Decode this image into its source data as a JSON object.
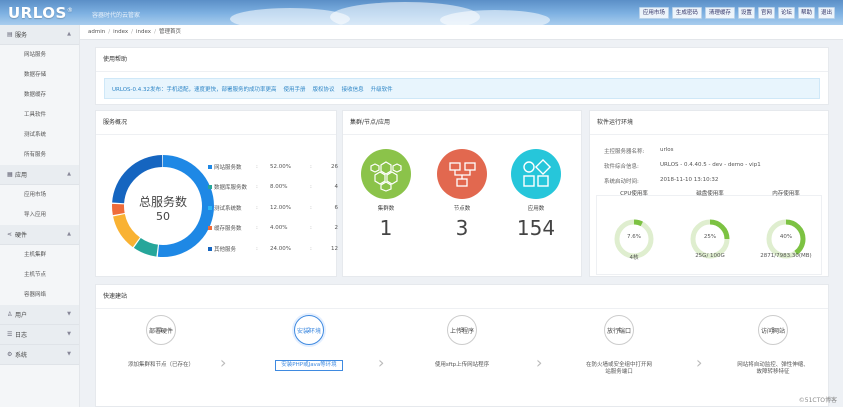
{
  "header": {
    "logo": "URLOS",
    "logo_mark": "®",
    "slogan": "容器时代的云管家",
    "buttons": [
      "应用市场",
      "生成密码",
      "清理缓存",
      "设置",
      "官网",
      "论坛",
      "帮助",
      "退出"
    ]
  },
  "sidebar": [
    {
      "label": "服务",
      "icon": "server-icon",
      "items": [
        "网站服务",
        "数据存储",
        "数据缓存",
        "工具软件",
        "测试系统",
        "所有服务"
      ]
    },
    {
      "label": "应用",
      "icon": "app-icon",
      "items": [
        "应用市场",
        "导入应用"
      ]
    },
    {
      "label": "硬件",
      "icon": "hardware-icon",
      "items": [
        "主机集群",
        "主机节点",
        "容器网络"
      ]
    },
    {
      "label": "用户",
      "icon": "user-icon",
      "items": []
    },
    {
      "label": "日志",
      "icon": "log-icon",
      "items": []
    },
    {
      "label": "系统",
      "icon": "system-icon",
      "items": []
    }
  ],
  "breadcrumb": [
    "admin",
    "index",
    "index",
    "管理首页"
  ],
  "help": {
    "title": "使用帮助",
    "links": [
      "URLOS-0.4.32发布：手机适配，速度更快，部署服务的成功率更高",
      "使用手册",
      "版权协议",
      "接收信息",
      "升级软件"
    ]
  },
  "overview": {
    "title": "服务概况",
    "center_label": "总服务数",
    "center_value": "50",
    "legend": [
      {
        "name": "网站服务数",
        "pct": "52.00%",
        "count": "26",
        "color": "#1e88e5"
      },
      {
        "name": "数据库服务数",
        "pct": "8.00%",
        "count": "4",
        "color": "#26a69a"
      },
      {
        "name": "测试系统数",
        "pct": "12.00%",
        "count": "6",
        "color": "#29b6f6"
      },
      {
        "name": "缓存服务数",
        "pct": "4.00%",
        "count": "2",
        "color": "#ef6c3a"
      },
      {
        "name": "其他服务",
        "pct": "24.00%",
        "count": "12",
        "color": "#1565c0"
      }
    ],
    "legend_sep": ":"
  },
  "chart_data": {
    "type": "pie",
    "title": "总服务数",
    "categories": [
      "网站服务数",
      "数据库服务数",
      "测试系统数",
      "缓存服务数",
      "其他服务"
    ],
    "values": [
      26,
      4,
      6,
      2,
      12
    ],
    "colors": [
      "#1e88e5",
      "#26a69a",
      "#f9b233",
      "#ef6c3a",
      "#1565c0"
    ]
  },
  "cluster": {
    "title": "集群/节点/应用",
    "stats": [
      {
        "label": "集群数",
        "value": "1",
        "color": "#8bc34a",
        "icon": "hexagon-icon"
      },
      {
        "label": "节点数",
        "value": "3",
        "color": "#e2684f",
        "icon": "network-icon"
      },
      {
        "label": "应用数",
        "value": "154",
        "color": "#26c6da",
        "icon": "apps-icon"
      }
    ]
  },
  "env": {
    "title": "软件运行环境",
    "rows": [
      {
        "k": "主控服务器名称:",
        "v": "urlos"
      },
      {
        "k": "软件综合信息:",
        "v": "URLOS - 0.4.40.5 - dev - demo - vip1"
      },
      {
        "k": "系统启动时间:",
        "v": "2018-11-10 13:10:32"
      }
    ],
    "gauges": [
      {
        "title": "CPU使用率",
        "pct": 7.6,
        "label": "7.6%",
        "sub": "4核"
      },
      {
        "title": "磁盘使用率",
        "pct": 25,
        "label": "25%",
        "sub": "25G/ 100G"
      },
      {
        "title": "内存使用率",
        "pct": 40,
        "label": "40%",
        "sub": "2871/7983.30(MB)"
      }
    ]
  },
  "quick": {
    "title": "快速建站",
    "steps": [
      {
        "num": "1",
        "name": "部署硬件",
        "desc": "添加集群和节点（已存在）"
      },
      {
        "num": "2",
        "name": "安装环境",
        "desc": "安装PHP或Java等环境"
      },
      {
        "num": "3",
        "name": "上传程序",
        "desc": "使用sftp上传网站程序"
      },
      {
        "num": "4",
        "name": "放行端口",
        "desc": "在防火墙或安全组中打开网站服务端口"
      },
      {
        "num": "5",
        "name": "访问网站",
        "desc": "网站将自动监控、弹性伸缩、故障转移特征"
      }
    ]
  },
  "watermark": "©51CTO博客"
}
